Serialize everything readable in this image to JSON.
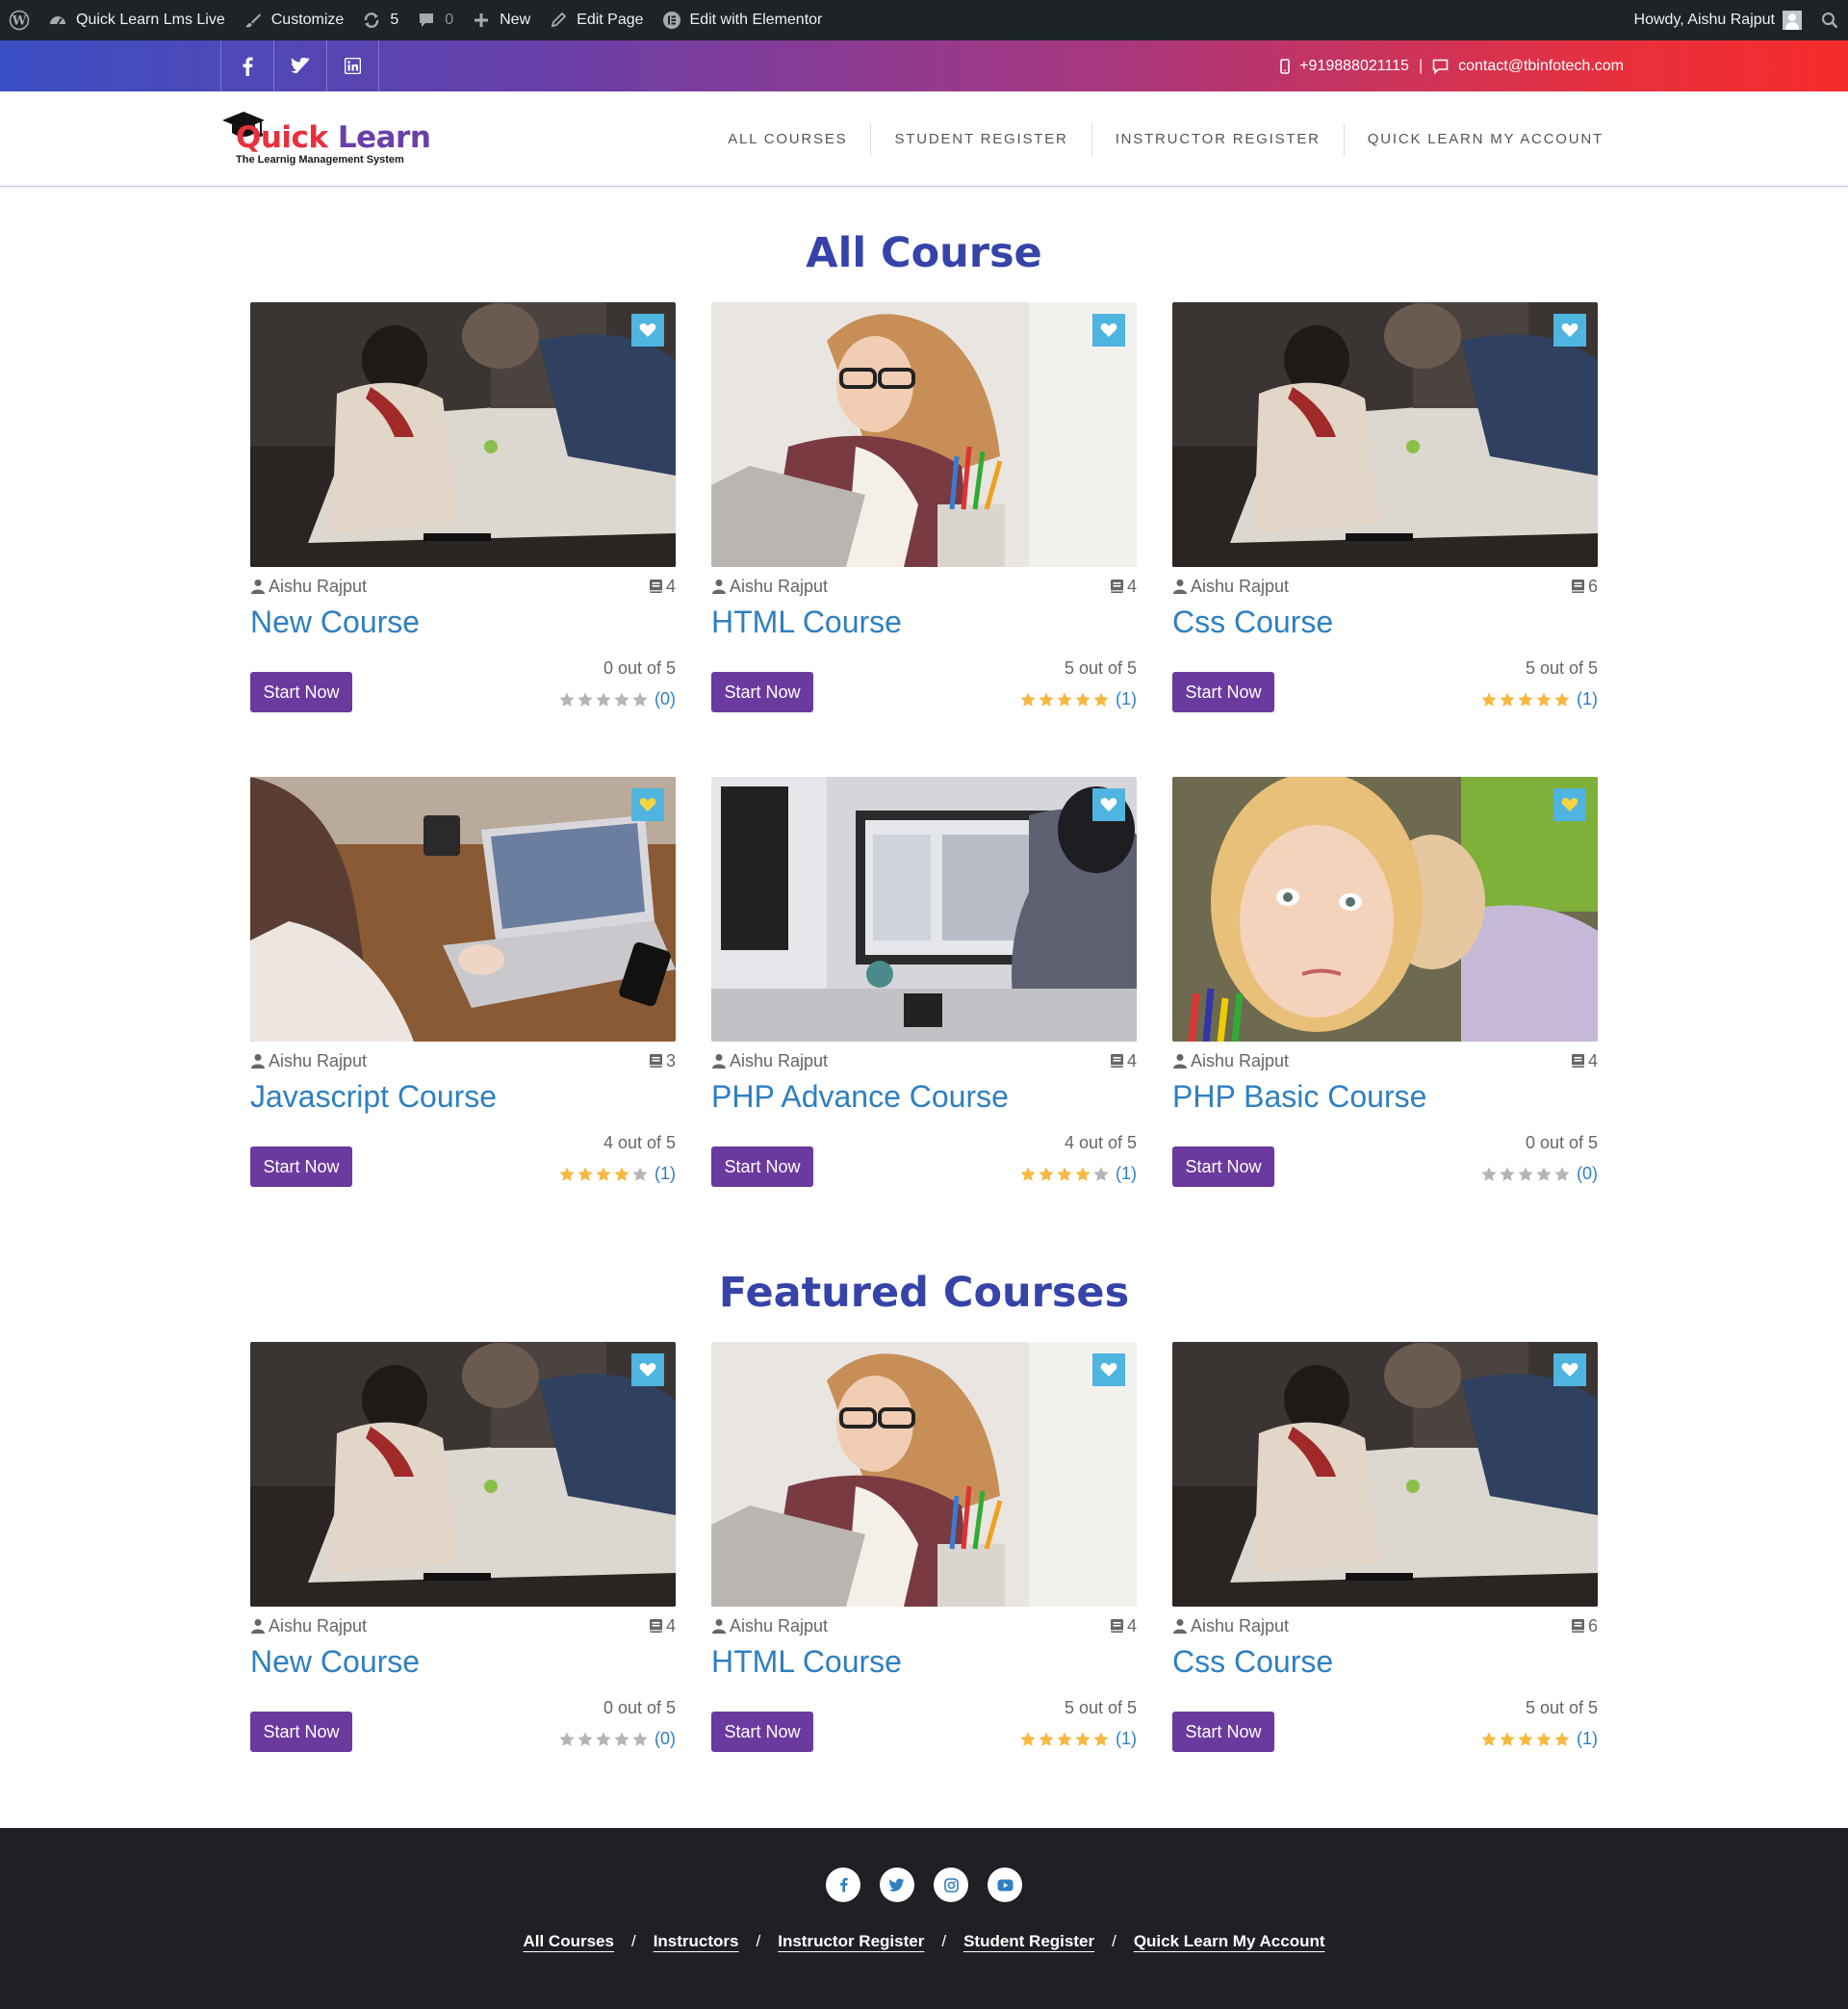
{
  "adminbar": {
    "site": "Quick Learn Lms Live",
    "customize": "Customize",
    "updates": "5",
    "comments": "0",
    "new": "New",
    "edit_page": "Edit Page",
    "elementor": "Edit with Elementor",
    "howdy": "Howdy, Aishu Rajput"
  },
  "topbar": {
    "phone": "+919888021115",
    "separator": "|",
    "email": "contact@tbinfotech.com"
  },
  "logo": {
    "quick": "Quick",
    "learn": " Learn",
    "tagline": "The Learnig Management System"
  },
  "nav": [
    "ALL COURSES",
    "STUDENT REGISTER",
    "INSTRUCTOR REGISTER",
    "QUICK LEARN MY ACCOUNT"
  ],
  "sections": {
    "all_title": "All Course",
    "featured_title": "Featured Courses"
  },
  "all_courses": [
    {
      "title": "New Course",
      "author": "Aishu Rajput",
      "lessons": "4",
      "rating_text": "0 out of 5",
      "rating": 0,
      "count": "(0)",
      "button": "Start Now",
      "heart": "#ffffff",
      "img": "group"
    },
    {
      "title": "HTML Course",
      "author": "Aishu Rajput",
      "lessons": "4",
      "rating_text": "5 out of 5",
      "rating": 5,
      "count": "(1)",
      "button": "Start Now",
      "heart": "#ffffff",
      "img": "girl"
    },
    {
      "title": "Css Course",
      "author": "Aishu Rajput",
      "lessons": "6",
      "rating_text": "5 out of 5",
      "rating": 5,
      "count": "(1)",
      "button": "Start Now",
      "heart": "#ffffff",
      "img": "group"
    },
    {
      "title": "Javascript Course",
      "author": "Aishu Rajput",
      "lessons": "3",
      "rating_text": "4 out of 5",
      "rating": 4,
      "count": "(1)",
      "button": "Start Now",
      "heart": "#f5d442",
      "img": "laptop"
    },
    {
      "title": "PHP Advance Course",
      "author": "Aishu Rajput",
      "lessons": "4",
      "rating_text": "4 out of 5",
      "rating": 4,
      "count": "(1)",
      "button": "Start Now",
      "heart": "#ffffff",
      "img": "monitor"
    },
    {
      "title": "PHP Basic Course",
      "author": "Aishu Rajput",
      "lessons": "4",
      "rating_text": "0 out of 5",
      "rating": 0,
      "count": "(0)",
      "button": "Start Now",
      "heart": "#f5d442",
      "img": "kid"
    }
  ],
  "featured_courses": [
    {
      "title": "New Course",
      "author": "Aishu Rajput",
      "lessons": "4",
      "rating_text": "0 out of 5",
      "rating": 0,
      "count": "(0)",
      "button": "Start Now",
      "heart": "#ffffff",
      "img": "group"
    },
    {
      "title": "HTML Course",
      "author": "Aishu Rajput",
      "lessons": "4",
      "rating_text": "5 out of 5",
      "rating": 5,
      "count": "(1)",
      "button": "Start Now",
      "heart": "#ffffff",
      "img": "girl"
    },
    {
      "title": "Css Course",
      "author": "Aishu Rajput",
      "lessons": "6",
      "rating_text": "5 out of 5",
      "rating": 5,
      "count": "(1)",
      "button": "Start Now",
      "heart": "#ffffff",
      "img": "group"
    }
  ],
  "footer": {
    "socials": [
      "facebook-icon",
      "twitter-icon",
      "instagram-icon",
      "youtube-icon"
    ],
    "links": [
      "All Courses",
      "Instructors",
      "Instructor Register",
      "Student Register",
      "Quick Learn My Account"
    ],
    "separator": "/"
  },
  "colors": {
    "accent_purple": "#6a3a9e",
    "title_blue": "#2f7fc1",
    "heading_blue": "#3643a8",
    "star_gold": "#f5b942",
    "star_gray": "#b5b5b5",
    "fav_bg": "#4fb4e0"
  }
}
